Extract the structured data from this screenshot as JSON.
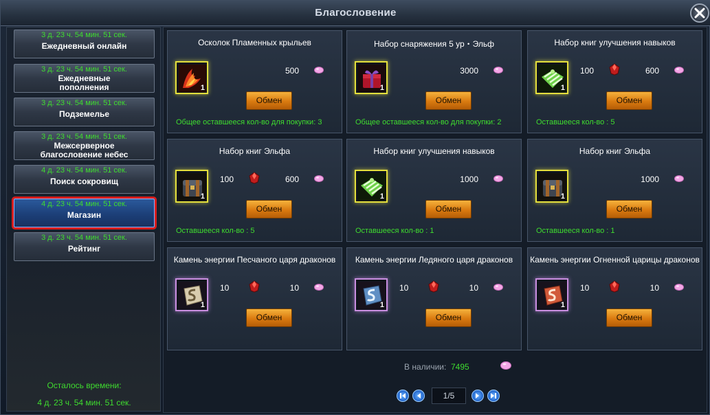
{
  "window": {
    "title": "Благословение"
  },
  "sidebar": {
    "items": [
      {
        "timer": "3 д. 23 ч. 54 мин. 51 сек.",
        "label": "Ежедневный онлайн"
      },
      {
        "timer": "3 д. 23 ч. 54 мин. 51 сек.",
        "label": "Ежедневные пополнения"
      },
      {
        "timer": "3 д. 23 ч. 54 мин. 51 сек.",
        "label": "Подземелье"
      },
      {
        "timer": "3 д. 23 ч. 54 мин. 51 сек.",
        "label": "Межсерверное благословение небес"
      },
      {
        "timer": "4 д. 23 ч. 54 мин. 51 сек.",
        "label": "Поиск сокровищ"
      },
      {
        "timer": "4 д. 23 ч. 54 мин. 51 сек.",
        "label": "Магазин"
      },
      {
        "timer": "3 д. 23 ч. 54 мин. 51 сек.",
        "label": "Рейтинг"
      }
    ],
    "active_item": "Магазин",
    "remaining_label": "Осталось времени:",
    "remaining_value": "4 д. 23 ч. 54 мин. 51 сек."
  },
  "shop": {
    "exchange_label": "Обмен",
    "items": [
      {
        "name": "Осколок Пламенных крыльев",
        "icon": "flame-wings-icon",
        "qty": "1",
        "cost1": "",
        "cost2": "500",
        "remain": "Общее оставшееся кол-во для покупки: 3"
      },
      {
        "name": "Набор снаряжения 5 ур・Эльф",
        "icon": "gift-box-icon",
        "qty": "1",
        "cost1": "",
        "cost2": "3000",
        "remain": "Общее оставшееся кол-во для покупки: 2"
      },
      {
        "name": "Набор книг улучшения навыков",
        "icon": "green-gift-icon",
        "qty": "1",
        "cost1": "100",
        "cost2": "600",
        "remain": "Оставшееся кол-во : 5"
      },
      {
        "name": "Набор книг Эльфа",
        "icon": "chest-icon",
        "qty": "1",
        "cost1": "100",
        "cost2": "600",
        "remain": "Оставшееся кол-во : 5"
      },
      {
        "name": "Набор книг улучшения навыков",
        "icon": "green-gift-icon",
        "qty": "1",
        "cost1": "",
        "cost2": "1000",
        "remain": "Оставшееся кол-во : 1"
      },
      {
        "name": "Набор книг Эльфа",
        "icon": "chest-icon",
        "qty": "1",
        "cost1": "",
        "cost2": "1000",
        "remain": "Оставшееся кол-во : 1"
      },
      {
        "name": "Камень энергии Песчаного царя драконов",
        "icon": "sand-stone-icon",
        "qty": "1",
        "cost1": "10",
        "cost2": "10",
        "remain": ""
      },
      {
        "name": "Камень энергии Ледяного царя драконов",
        "icon": "ice-stone-icon",
        "qty": "1",
        "cost1": "10",
        "cost2": "10",
        "remain": ""
      },
      {
        "name": "Камень энергии Огненной царицы драконов",
        "icon": "fire-stone-icon",
        "qty": "1",
        "cost1": "10",
        "cost2": "10",
        "remain": ""
      }
    ],
    "balance_label": "В наличии:",
    "balance_value": "7495"
  },
  "pagination": {
    "label": "1/5"
  }
}
